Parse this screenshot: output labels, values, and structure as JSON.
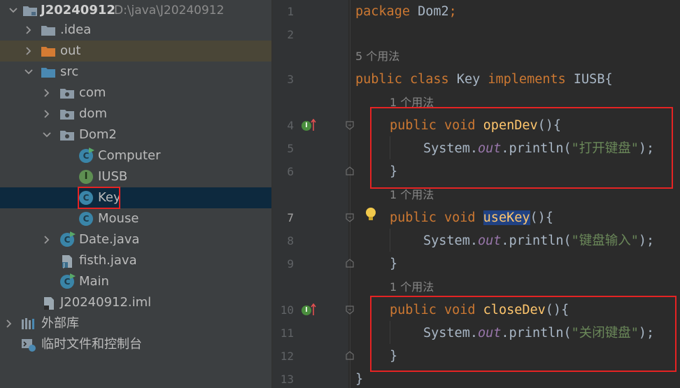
{
  "project_tree": {
    "root": {
      "name": "J20240912",
      "path": "D:\\java\\J20240912"
    },
    "items": [
      {
        "label": ".idea"
      },
      {
        "label": "out"
      },
      {
        "label": "src"
      },
      {
        "label": "com"
      },
      {
        "label": "dom"
      },
      {
        "label": "Dom2"
      },
      {
        "label": "Computer"
      },
      {
        "label": "IUSB"
      },
      {
        "label": "Key"
      },
      {
        "label": "Mouse"
      },
      {
        "label": "Date.java"
      },
      {
        "label": "fisth.java"
      },
      {
        "label": "Main"
      },
      {
        "label": "J20240912.iml"
      },
      {
        "label": "外部库"
      },
      {
        "label": "临时文件和控制台"
      }
    ]
  },
  "editor": {
    "line_numbers": [
      "1",
      "2",
      "3",
      "4",
      "5",
      "6",
      "7",
      "8",
      "9",
      "10",
      "11",
      "12",
      "13"
    ],
    "usage_hints": {
      "class": "5 个用法",
      "open": "1 个用法",
      "use": "1 个用法",
      "close": "1 个用法"
    },
    "tokens": {
      "package_kw": "package",
      "package_name": "Dom2",
      "semi": ";",
      "public": "public",
      "class": "class",
      "class_name": "Key",
      "implements": "implements",
      "iface": "IUSB",
      "brace_open": "{",
      "void": "void",
      "open_name": "openDev",
      "use_name": "useKey",
      "close_name": "closeDev",
      "parens": "()",
      "system": "System.",
      "out": "out",
      "println": ".println(",
      "str_open": "\"打开键盘\"",
      "str_use": "\"键盘输入\"",
      "str_close": "\"关闭键盘\"",
      "call_end": ");",
      "brace_close": "}"
    }
  },
  "colors": {
    "keyword": "#cc7832",
    "method": "#ffc66d",
    "string": "#6a8759",
    "field": "#9876aa",
    "annotation_box": "#e52323"
  }
}
